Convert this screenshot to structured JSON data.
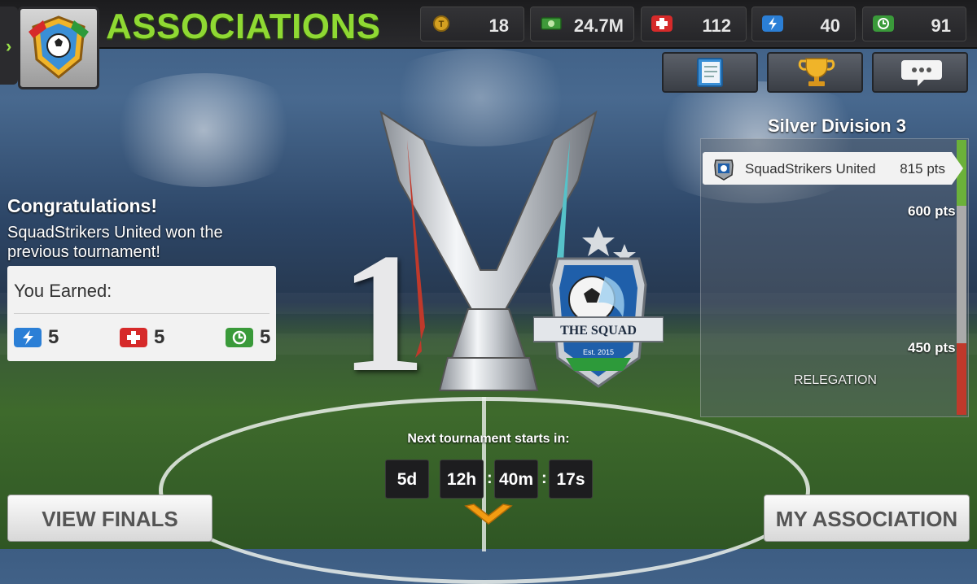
{
  "header": {
    "title": "ASSOCIATIONS",
    "back_arrow": "›",
    "badge_icon": "association-badge-icon"
  },
  "resources": [
    {
      "name": "tokens",
      "icon": "token-coin-icon",
      "value": "18",
      "color": "#d4a021"
    },
    {
      "name": "money",
      "icon": "cash-icon",
      "value": "24.7M",
      "color": "#3f9a3a"
    },
    {
      "name": "health",
      "icon": "health-cross-icon",
      "value": "112",
      "color": "#d62a2a"
    },
    {
      "name": "energy",
      "icon": "energy-bolt-icon",
      "value": "40",
      "color": "#2b7fd6"
    },
    {
      "name": "training",
      "icon": "training-refresh-icon",
      "value": "91",
      "color": "#3a9a3a"
    }
  ],
  "toolbar": {
    "notes_icon": "clipboard-icon",
    "trophy_icon": "trophy-icon",
    "chat_icon": "chat-icon"
  },
  "congrats": {
    "heading": "Congratulations!",
    "message": "SquadStrikers United won the previous tournament!"
  },
  "earned": {
    "title": "You Earned:",
    "rewards": [
      {
        "icon": "energy-bolt-icon",
        "value": "5",
        "color": "#2b7fd6"
      },
      {
        "icon": "health-cross-icon",
        "value": "5",
        "color": "#d62a2a"
      },
      {
        "icon": "training-refresh-icon",
        "value": "5",
        "color": "#3a9a3a"
      }
    ]
  },
  "trophy": {
    "place_number": "1",
    "crest_text": "THE SQUAD",
    "crest_est": "Est. 2015"
  },
  "division": {
    "title": "Silver Division 3",
    "team_name": "SquadStrikers United",
    "team_points": "815 pts",
    "promotion_mark": "600 pts",
    "relegation_mark": "450 pts",
    "relegation_label": "RELEGATION",
    "colors": {
      "promotion": "#6bb13a",
      "neutral": "#aaaaaa",
      "relegation": "#c0392b"
    }
  },
  "countdown": {
    "label": "Next tournament starts in:",
    "days": "5d",
    "hours": "12h",
    "minutes": "40m",
    "seconds": "17s",
    "separator": ":"
  },
  "buttons": {
    "view_finals": "VIEW FINALS",
    "my_association": "MY ASSOCIATION"
  },
  "colors": {
    "title_green": "#8fd933",
    "accent_orange": "#f39c12"
  }
}
